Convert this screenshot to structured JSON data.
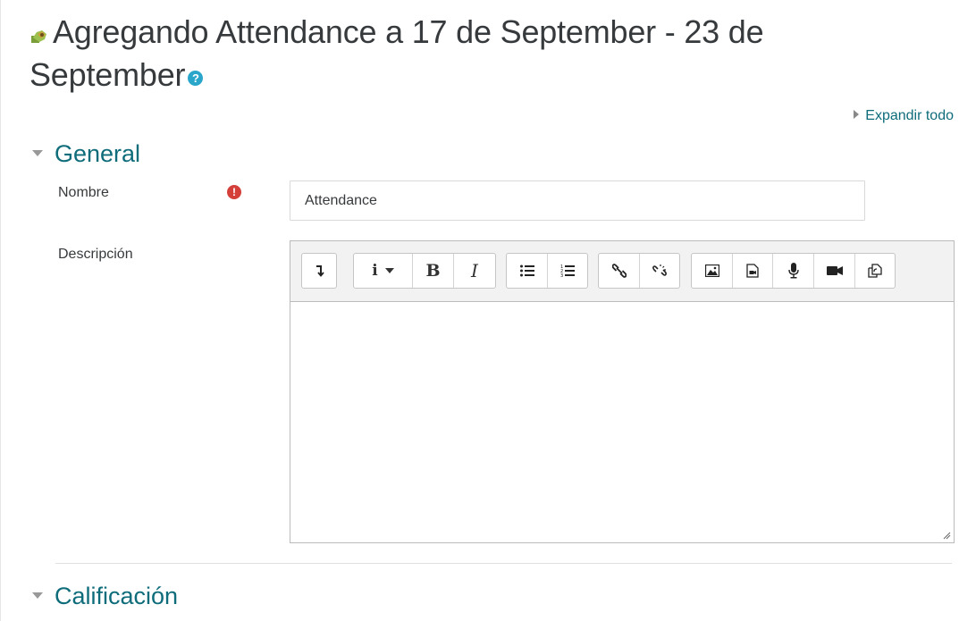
{
  "page": {
    "title": "Agregando Attendance a 17 de September - 23 de September",
    "expand_all": "Expandir todo"
  },
  "sections": {
    "general": {
      "label": "General"
    },
    "grading": {
      "label": "Calificación"
    }
  },
  "form": {
    "name": {
      "label": "Nombre",
      "value": "Attendance"
    },
    "description": {
      "label": "Descripción",
      "value": ""
    }
  },
  "toolbar": {
    "buttons": [
      "toolbar-toggle",
      "info-dropdown",
      "bold",
      "italic",
      "unordered-list",
      "ordered-list",
      "link",
      "unlink",
      "image",
      "media",
      "record-audio",
      "record-video",
      "manage-files"
    ]
  },
  "colors": {
    "link_teal": "#0f6c7a",
    "required_red": "#d43f3a",
    "help_blue": "#2ba6cb"
  }
}
